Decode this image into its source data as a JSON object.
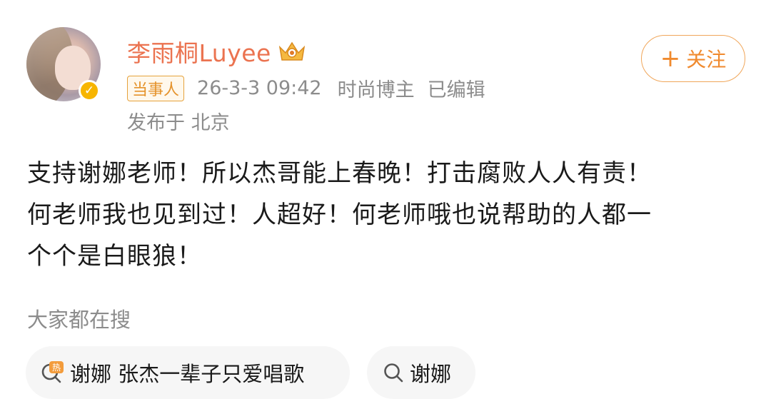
{
  "post": {
    "author": {
      "name": "李雨桐Luyee",
      "avatar": "user-avatar",
      "verified_icon": "verified-badge-icon",
      "crown_icon": "vip-crown-icon"
    },
    "tag": "当事人",
    "timestamp": "26-3-3 09:42",
    "role": "时尚博主",
    "edited": "已编辑",
    "location": "发布于 北京",
    "follow_button": {
      "plus": "+",
      "label": "关注"
    },
    "content": [
      "支持谢娜老师！所以杰哥能上春晚！打击腐败人人有责！",
      "何老师我也见到过！人超好！何老师哦也说帮助的人都一",
      "个个是白眼狼！"
    ]
  },
  "search": {
    "title": "大家都在搜",
    "chips": [
      {
        "icon": "hot-search-icon",
        "label": "谢娜 张杰一辈子只爱唱歌"
      },
      {
        "icon": "search-icon",
        "label": "谢娜"
      }
    ]
  },
  "colors": {
    "name": "#eb7350",
    "follow": "#f08a2e",
    "tag": "#e5932c",
    "meta": "#8c8c8c",
    "badge": "#f7b500"
  }
}
